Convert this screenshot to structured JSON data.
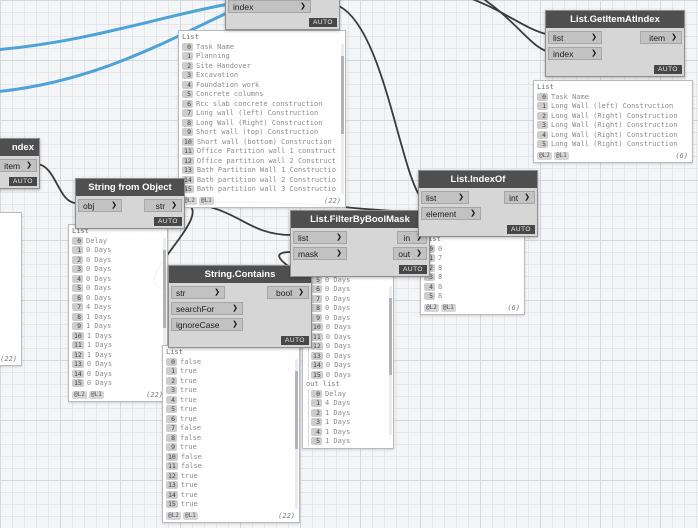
{
  "colors": {
    "wire": "#3a3a3a",
    "wire_highlight": "#3f9bd5",
    "node_header": "#4f4f4f",
    "node_body": "#d6d6d6",
    "port_chip": "#c2c2c2",
    "auto_badge": "#474747",
    "preview_bg": "#ffffff",
    "grid_minor": "#e3e7ea",
    "grid_major": "#d2d8de"
  },
  "nodes": {
    "top_partial": {
      "input": "index",
      "auto": "AUTO"
    },
    "get_item_at_index": {
      "title": "List.GetItemAtIndex",
      "inputs": [
        "list",
        "index"
      ],
      "output": "item",
      "auto": "AUTO"
    },
    "left_partial": {
      "title_fragment": "ndex",
      "output": "item",
      "auto": "AUTO"
    },
    "string_from_object": {
      "title": "String from Object",
      "input": "obj",
      "output": "str",
      "auto": "AUTO"
    },
    "string_contains": {
      "title": "String.Contains",
      "inputs": [
        "str",
        "searchFor",
        "ignoreCase"
      ],
      "output": "bool",
      "auto": "AUTO"
    },
    "filter_by_bool_mask": {
      "title": "List.FilterByBoolMask",
      "inputs": [
        "list",
        "mask"
      ],
      "outputs": [
        "in",
        "out"
      ],
      "auto": "AUTO"
    },
    "index_of": {
      "title": "List.IndexOf",
      "inputs": [
        "list",
        "element"
      ],
      "output": "int",
      "auto": "AUTO"
    }
  },
  "previews": {
    "center": {
      "root": "List",
      "items": [
        {
          "i": "0",
          "v": "Task Name"
        },
        {
          "i": "1",
          "v": "Planning"
        },
        {
          "i": "2",
          "v": "Site Handover"
        },
        {
          "i": "3",
          "v": "Excavation"
        },
        {
          "i": "4",
          "v": "Foundation work"
        },
        {
          "i": "5",
          "v": "Concrete columns"
        },
        {
          "i": "6",
          "v": "Rcc slab concrete construction"
        },
        {
          "i": "7",
          "v": "Long wall (left) Construction"
        },
        {
          "i": "8",
          "v": "Long Wall (Right) Construction"
        },
        {
          "i": "9",
          "v": "Short wall (top) Construction"
        },
        {
          "i": "10",
          "v": "Short wall (bottom) Construction"
        },
        {
          "i": "11",
          "v": "Office Partition wall 1 construct"
        },
        {
          "i": "12",
          "v": "Office partition wall 2 Construct"
        },
        {
          "i": "13",
          "v": "Bath Partition Wall 1 Constructio"
        },
        {
          "i": "14",
          "v": "Bath partition wall 2 Constructio"
        },
        {
          "i": "15",
          "v": "Bath partition wall 3 Constructio"
        }
      ],
      "lacing": [
        "@L2",
        "@L1"
      ],
      "count": "(22)"
    },
    "get_item": {
      "root": "List",
      "items": [
        {
          "i": "0",
          "v": "Task Name"
        },
        {
          "i": "1",
          "v": "Long Wall (left) Construction"
        },
        {
          "i": "2",
          "v": "Long Wall (Right) Construction"
        },
        {
          "i": "3",
          "v": "Long Wall (Right) Construction"
        },
        {
          "i": "4",
          "v": "Long Wall (Right) Construction"
        },
        {
          "i": "5",
          "v": "Long Wall (Right) Construction"
        }
      ],
      "lacing": [
        "@L2",
        "@L1"
      ],
      "count": "(6)"
    },
    "string_from_object": {
      "root": "List",
      "items": [
        {
          "i": "0",
          "v": "Delay"
        },
        {
          "i": "1",
          "v": "0 Days"
        },
        {
          "i": "2",
          "v": "0 Days"
        },
        {
          "i": "3",
          "v": "0 Days"
        },
        {
          "i": "4",
          "v": "0 Days"
        },
        {
          "i": "5",
          "v": "0 Days"
        },
        {
          "i": "6",
          "v": "0 Days"
        },
        {
          "i": "7",
          "v": "4 Days"
        },
        {
          "i": "8",
          "v": "1 Days"
        },
        {
          "i": "9",
          "v": "1 Days"
        },
        {
          "i": "10",
          "v": "1 Days"
        },
        {
          "i": "11",
          "v": "1 Days"
        },
        {
          "i": "12",
          "v": "1 Days"
        },
        {
          "i": "13",
          "v": "0 Days"
        },
        {
          "i": "14",
          "v": "0 Days"
        },
        {
          "i": "15",
          "v": "0 Days"
        }
      ],
      "lacing": [
        "@L2",
        "@L1"
      ],
      "count": "(22)"
    },
    "string_contains": {
      "root": "List",
      "items": [
        {
          "i": "0",
          "v": "false"
        },
        {
          "i": "1",
          "v": "true"
        },
        {
          "i": "2",
          "v": "true"
        },
        {
          "i": "3",
          "v": "true"
        },
        {
          "i": "4",
          "v": "true"
        },
        {
          "i": "5",
          "v": "true"
        },
        {
          "i": "6",
          "v": "true"
        },
        {
          "i": "7",
          "v": "false"
        },
        {
          "i": "8",
          "v": "false"
        },
        {
          "i": "9",
          "v": "true"
        },
        {
          "i": "10",
          "v": "false"
        },
        {
          "i": "11",
          "v": "false"
        },
        {
          "i": "12",
          "v": "true"
        },
        {
          "i": "13",
          "v": "true"
        },
        {
          "i": "14",
          "v": "true"
        },
        {
          "i": "15",
          "v": "true"
        }
      ],
      "lacing": [
        "@L2",
        "@L1"
      ],
      "count": "(22)"
    },
    "filter": {
      "in_items": [
        {
          "i": "5",
          "v": "0 Days"
        },
        {
          "i": "6",
          "v": "0 Days"
        },
        {
          "i": "7",
          "v": "0 Days"
        },
        {
          "i": "8",
          "v": "0 Days"
        },
        {
          "i": "9",
          "v": "0 Days"
        },
        {
          "i": "10",
          "v": "0 Days"
        },
        {
          "i": "11",
          "v": "0 Days"
        },
        {
          "i": "12",
          "v": "0 Days"
        },
        {
          "i": "13",
          "v": "0 Days"
        },
        {
          "i": "14",
          "v": "0 Days"
        },
        {
          "i": "15",
          "v": "0 Days"
        }
      ],
      "out_label": "out list",
      "out_items": [
        {
          "i": "0",
          "v": "Delay"
        },
        {
          "i": "1",
          "v": "4 Days"
        },
        {
          "i": "2",
          "v": "1 Days"
        },
        {
          "i": "3",
          "v": "1 Days"
        },
        {
          "i": "4",
          "v": "1 Days"
        },
        {
          "i": "5",
          "v": "1 Days"
        }
      ]
    },
    "index_of": {
      "root": "List",
      "items": [
        {
          "i": "0",
          "v": "0"
        },
        {
          "i": "1",
          "v": "7"
        },
        {
          "i": "2",
          "v": "8"
        },
        {
          "i": "3",
          "v": "8"
        },
        {
          "i": "4",
          "v": "8"
        },
        {
          "i": "5",
          "v": "8"
        }
      ],
      "lacing": [
        "@L2",
        "@L1"
      ],
      "count": "(6)"
    },
    "left_partial": {
      "count": "(22)"
    }
  }
}
